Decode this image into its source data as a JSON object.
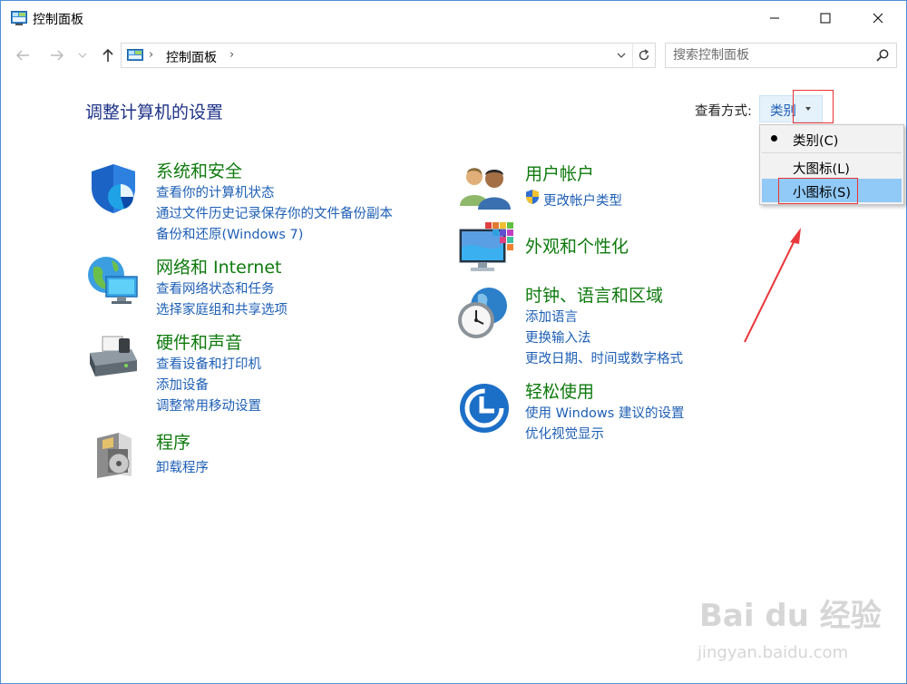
{
  "window": {
    "title": "控制面板"
  },
  "address": {
    "path": "控制面板",
    "search_placeholder": "搜索控制面板"
  },
  "main": {
    "heading": "调整计算机的设置",
    "view_label": "查看方式:",
    "view_value": "类别"
  },
  "menu": {
    "items": [
      {
        "label": "类别(C)",
        "selected": true
      },
      {
        "label": "大图标(L)"
      },
      {
        "label": "小图标(S)",
        "highlighted": true
      }
    ]
  },
  "categories_left": [
    {
      "title": "系统和安全",
      "links": [
        "查看你的计算机状态",
        "通过文件历史记录保存你的文件备份副本",
        "备份和还原(Windows 7)"
      ]
    },
    {
      "title": "网络和 Internet",
      "links": [
        "查看网络状态和任务",
        "选择家庭组和共享选项"
      ]
    },
    {
      "title": "硬件和声音",
      "links": [
        "查看设备和打印机",
        "添加设备",
        "调整常用移动设置"
      ]
    },
    {
      "title": "程序",
      "links": [
        "卸载程序"
      ]
    }
  ],
  "categories_right": [
    {
      "title": "用户帐户",
      "links": [
        "更改帐户类型"
      ]
    },
    {
      "title": "外观和个性化",
      "links": []
    },
    {
      "title": "时钟、语言和区域",
      "links": [
        "添加语言",
        "更换输入法",
        "更改日期、时间或数字格式"
      ]
    },
    {
      "title": "轻松使用",
      "links": [
        "使用 Windows 建议的设置",
        "优化视觉显示"
      ]
    }
  ],
  "watermark": {
    "brand": "Bai du 经验",
    "url": "jingyan.baidu.com"
  },
  "colors": {
    "link": "#1e5fb5",
    "category_title": "#0e7a0d",
    "heading": "#1e3287",
    "menu_highlight": "#91c9f7"
  }
}
